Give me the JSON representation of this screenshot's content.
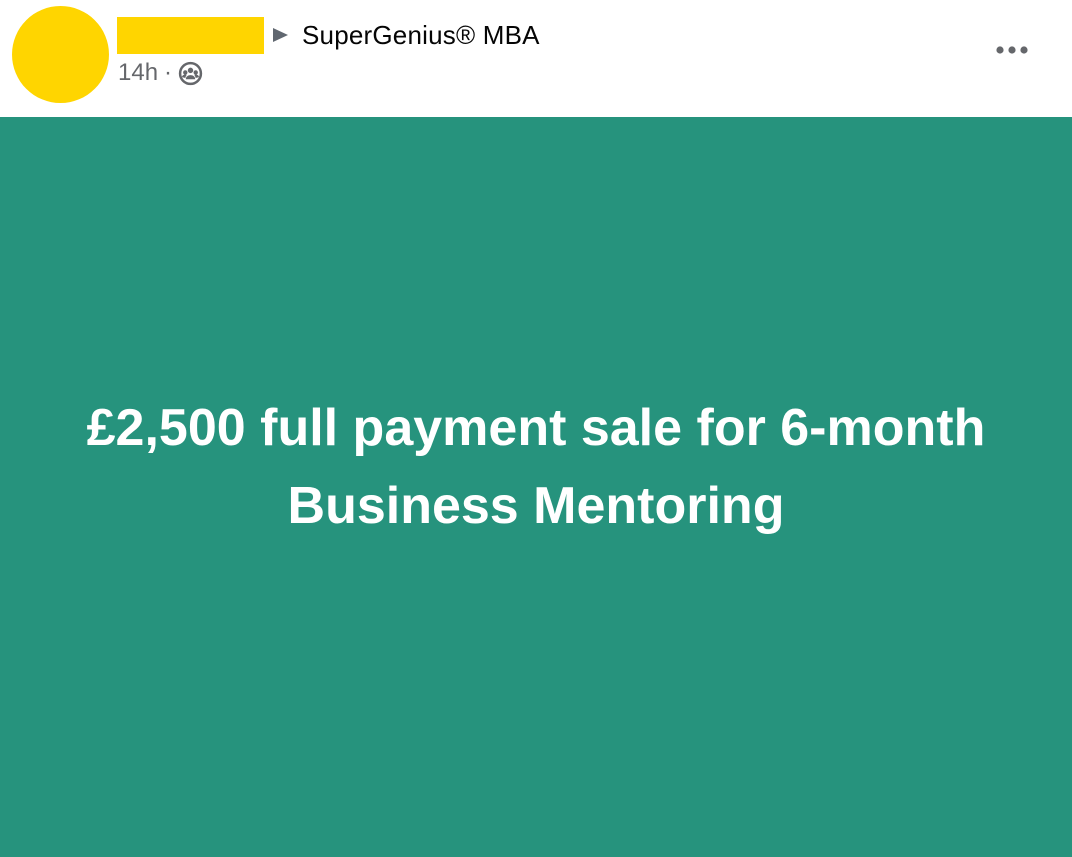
{
  "post": {
    "group_name": "SuperGenius® MBA",
    "timestamp": "14h",
    "separator": "·",
    "audience_icon": "group-icon",
    "more_icon": "more-options-icon",
    "banner_text": "£2,500 full payment sale for 6-month Business Mentoring"
  },
  "colors": {
    "avatar": "#FFD500",
    "redaction": "#FFD500",
    "banner_background": "#26937D",
    "banner_text": "#FFFFFF",
    "secondary_text": "#65676B",
    "primary_text": "#050505"
  }
}
